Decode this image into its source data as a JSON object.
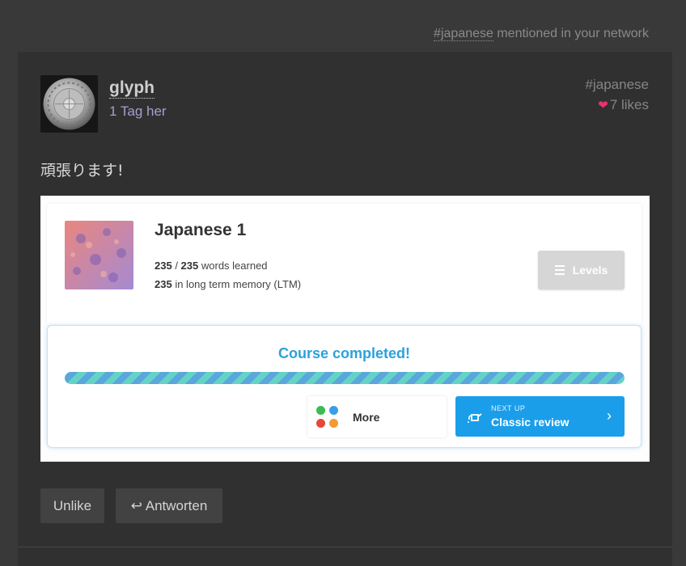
{
  "network_mention": {
    "tag": "#japanese",
    "text": " mentioned in your network"
  },
  "post": {
    "author": {
      "name": "glyph",
      "tagline": "1 Tag her"
    },
    "tag": "#japanese",
    "likes": {
      "icon": "heart-icon",
      "text": "7 likes"
    },
    "text": "頑張ります!"
  },
  "course_card": {
    "title": "Japanese 1",
    "words_learned": "235",
    "words_total": "235",
    "words_label": "words learned",
    "ltm_count": "235",
    "ltm_label": "in long term memory (LTM)",
    "levels_button": "Levels",
    "completed_text": "Course completed!",
    "progress": 1.0,
    "more_label": "More",
    "next_up_caption": "NEXT UP",
    "next_up_label": "Classic review",
    "colors": {
      "accent_blue": "#1a9eea",
      "title_blue": "#2ca1dc",
      "dot_green": "#3cba54",
      "dot_blue": "#3a9de8",
      "dot_red": "#e8453c",
      "dot_orange": "#f49a33"
    }
  },
  "actions": {
    "unlike": "Unlike",
    "reply": "↩ Antworten"
  }
}
